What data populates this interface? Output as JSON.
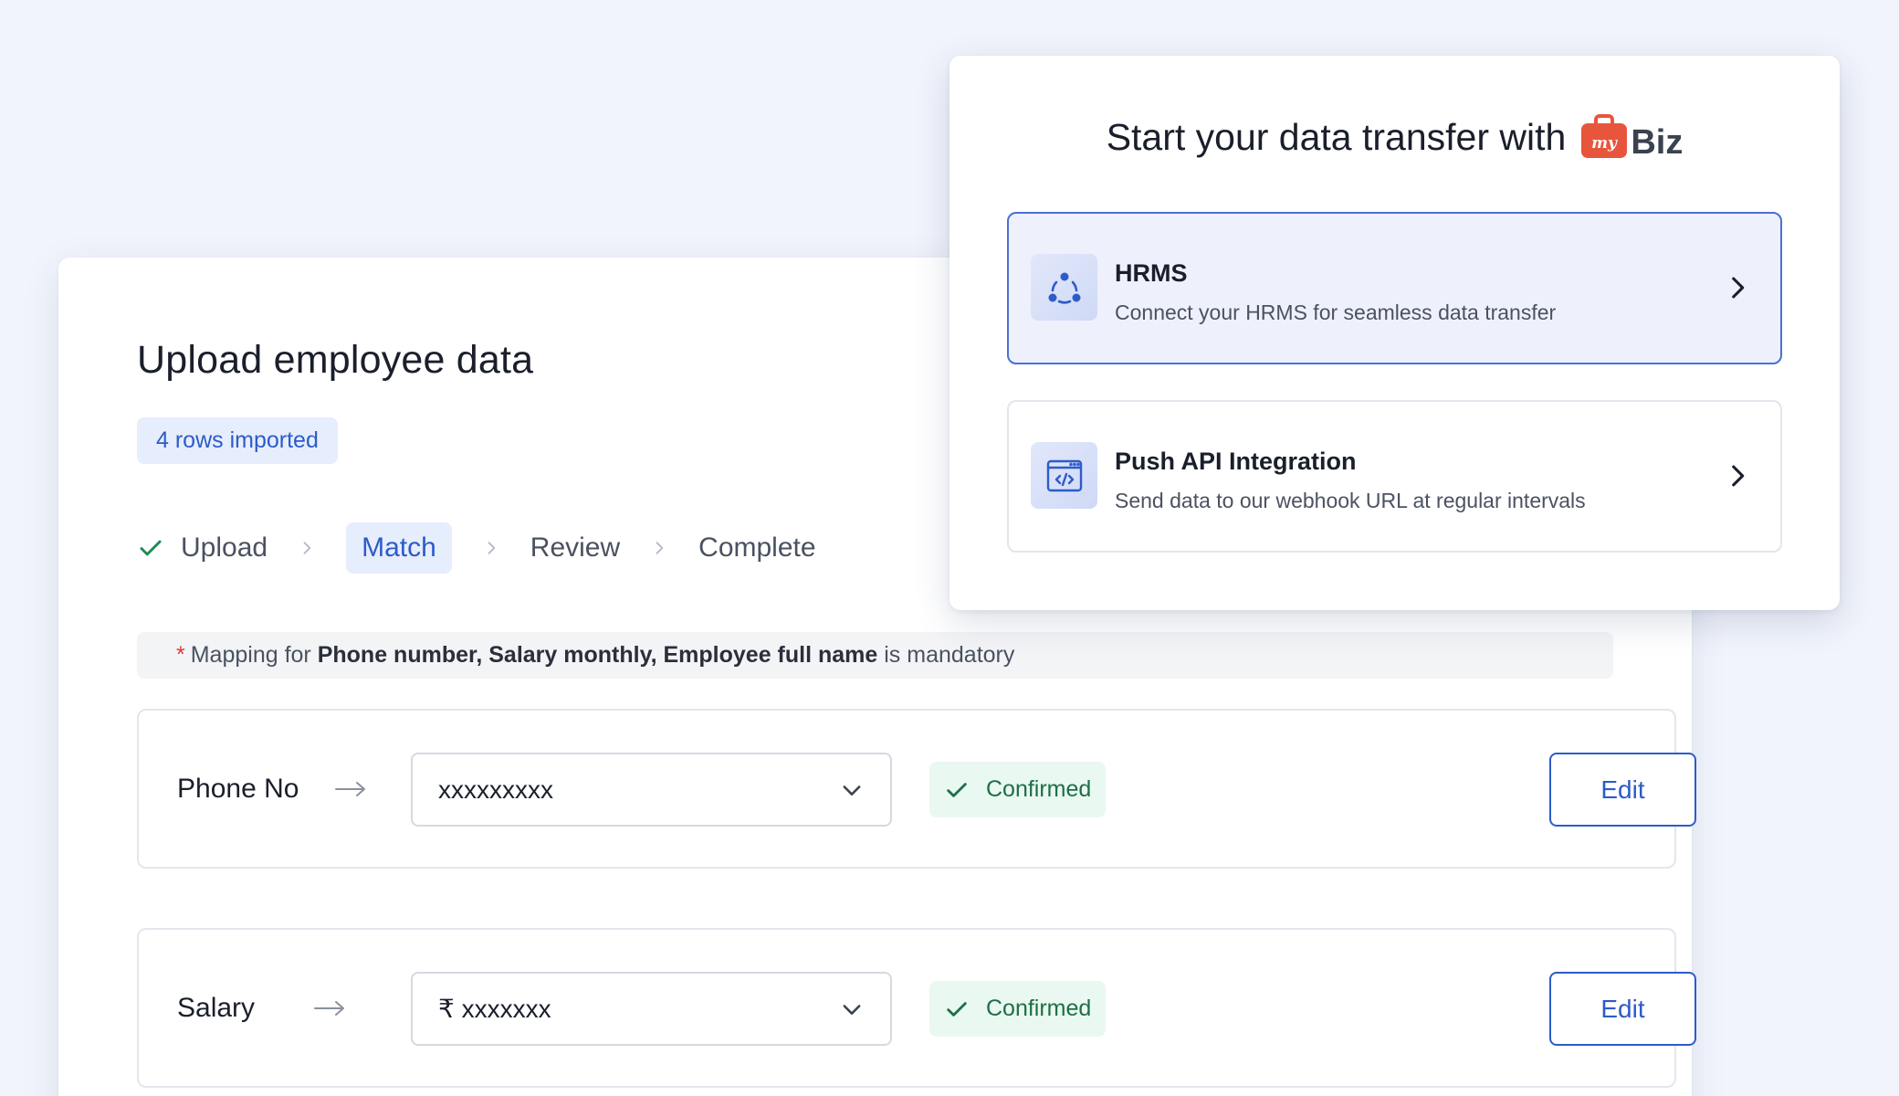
{
  "upload": {
    "title": "Upload employee data",
    "rows_badge": "4 rows imported",
    "steps": [
      {
        "label": "Upload",
        "state": "done"
      },
      {
        "label": "Match",
        "state": "active"
      },
      {
        "label": "Review",
        "state": "pending"
      },
      {
        "label": "Complete",
        "state": "pending"
      }
    ],
    "mandatory": {
      "star": "*",
      "prefix": "Mapping for",
      "fields": "Phone number, Salary monthly, Employee full name",
      "suffix": "is mandatory"
    },
    "mappings": [
      {
        "label": "Phone No",
        "value": "xxxxxxxxx",
        "status": "Confirmed",
        "action": "Edit"
      },
      {
        "label": "Salary",
        "value": "₹ xxxxxxx",
        "status": "Confirmed",
        "action": "Edit"
      }
    ]
  },
  "transfer": {
    "title": "Start your data transfer with",
    "logo_text": "Biz",
    "logo_badge": "my",
    "options": [
      {
        "title": "HRMS",
        "description": "Connect your HRMS for seamless data transfer",
        "icon": "network-icon",
        "selected": true
      },
      {
        "title": "Push API Integration",
        "description": "Send data to our webhook URL at regular intervals",
        "icon": "code-window-icon",
        "selected": false
      }
    ]
  },
  "colors": {
    "accent": "#2d5bc9",
    "success": "#1f6e48",
    "success_bg": "#e9f8f0",
    "brand": "#e8553d",
    "page_bg": "#f1f4fb"
  }
}
